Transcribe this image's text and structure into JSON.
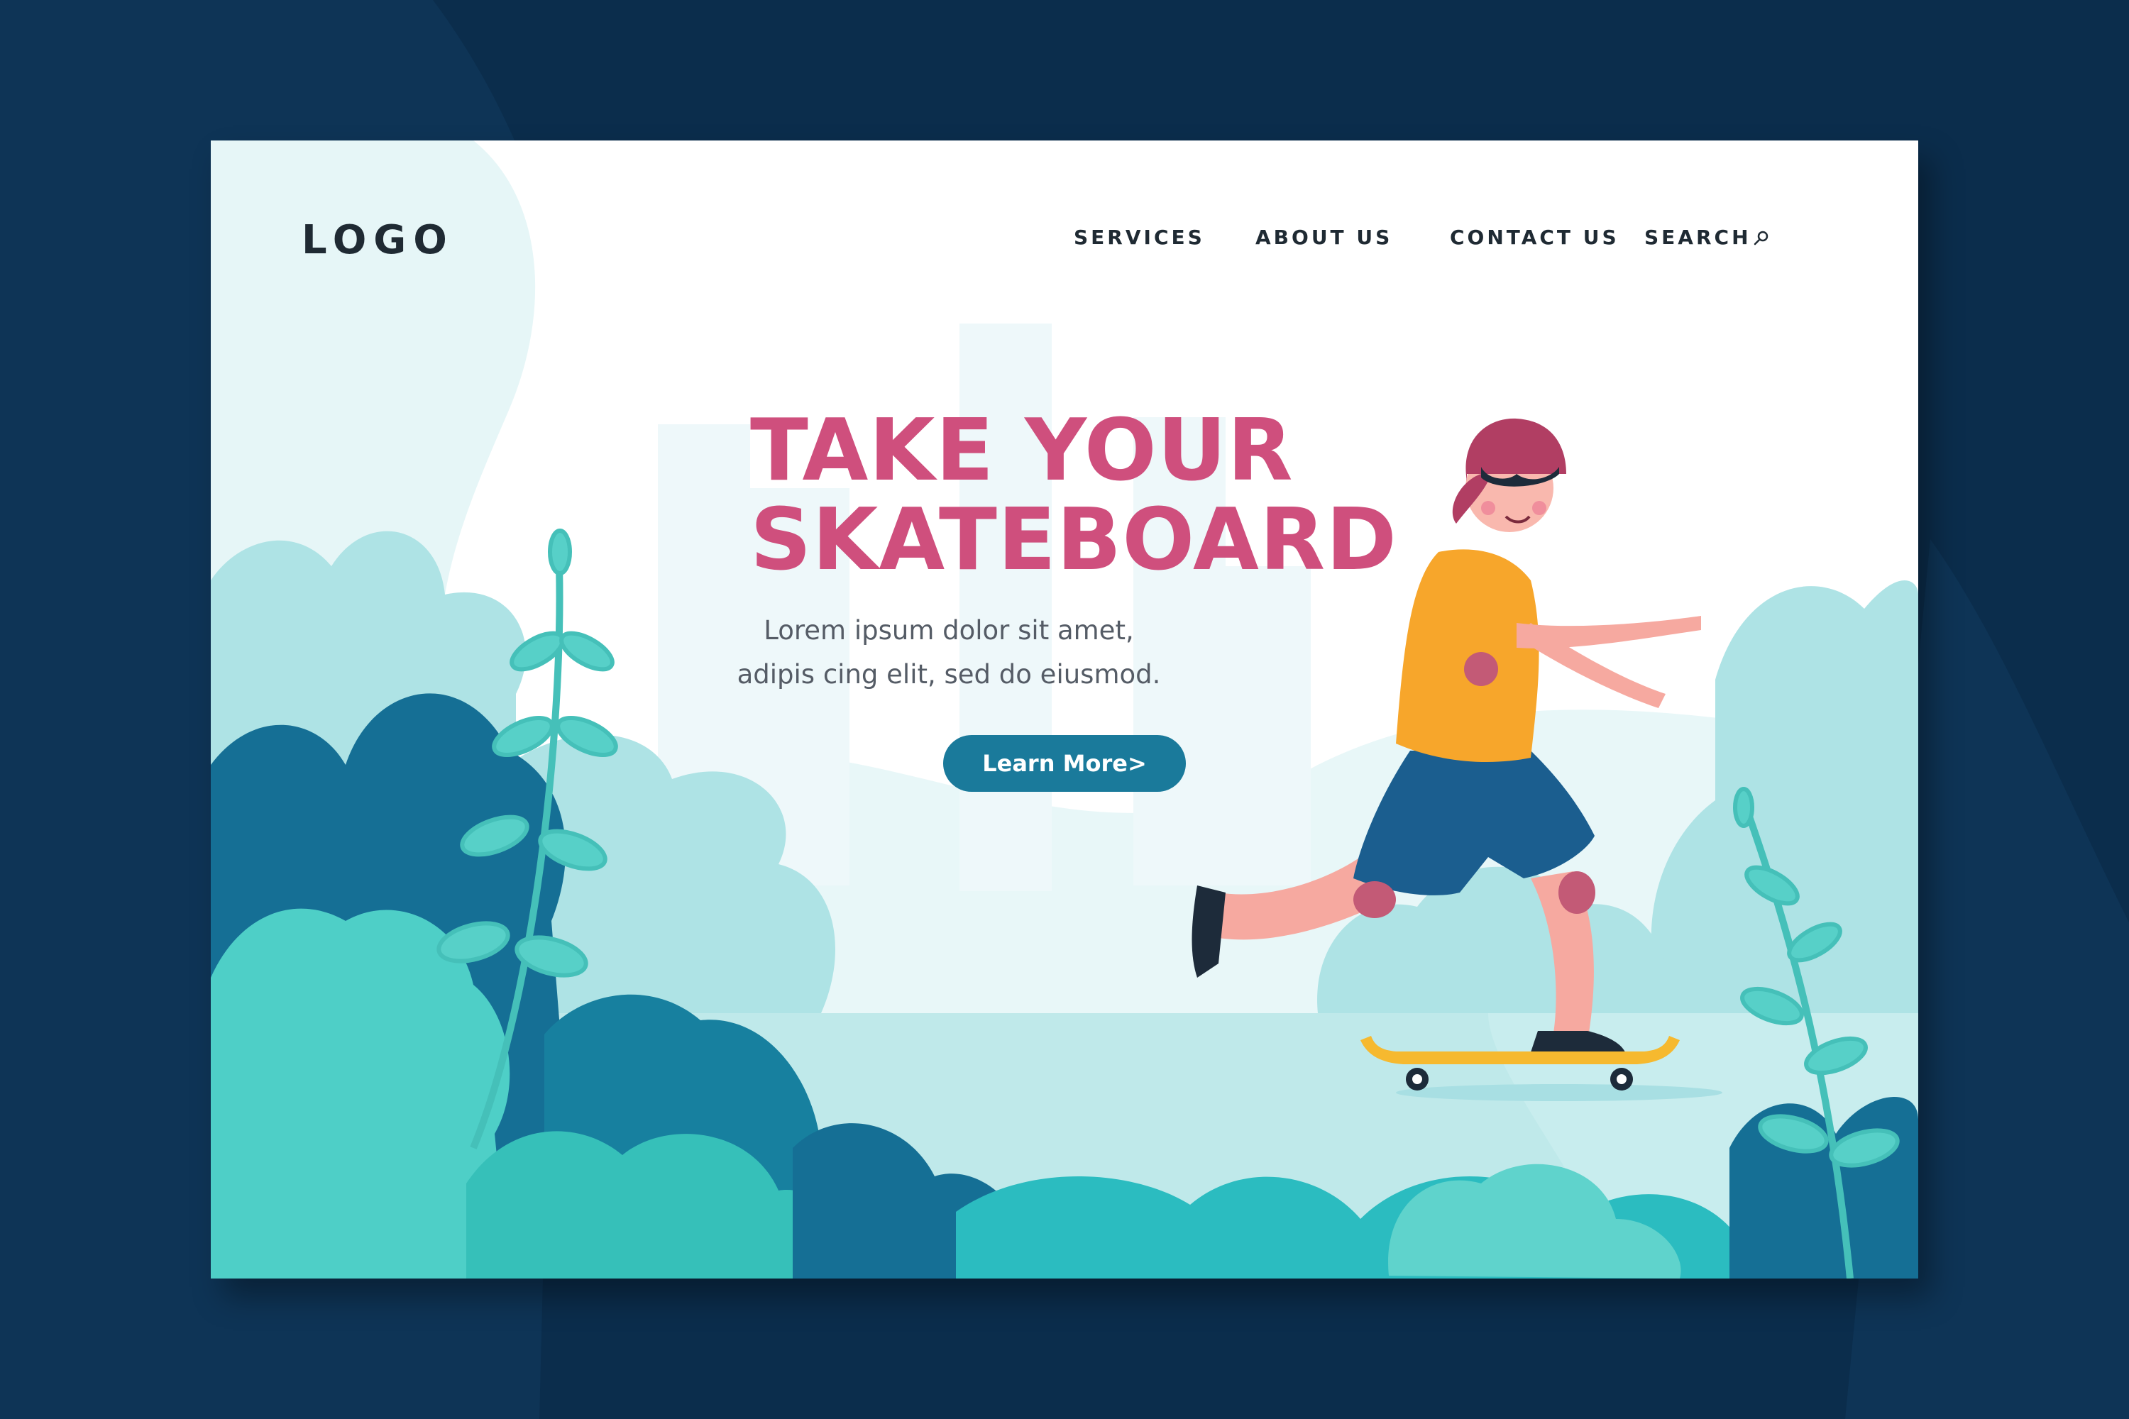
{
  "header": {
    "logo": "LOGO",
    "nav": {
      "services": "SERVICES",
      "about": "ABOUT US",
      "contact": "CONTACT US",
      "search": "SEARCH"
    }
  },
  "hero": {
    "title_line1": "TAKE YOUR",
    "title_line2": "SKATEBOARD",
    "subtitle_line1": "Lorem ipsum dolor sit amet,",
    "subtitle_line2": "adipis cing elit, sed do eiusmod.",
    "cta_label": "Learn More>"
  },
  "colors": {
    "page_background": "#0b2d4c",
    "accent_pink": "#cf4f7d",
    "button_blue": "#1a7a9b",
    "foliage_teal": "#2fb3b0",
    "foliage_dark": "#156f95",
    "shirt_orange": "#f7a62b",
    "board_yellow": "#f6b92f"
  },
  "icons": {
    "search": "magnifier-icon"
  }
}
